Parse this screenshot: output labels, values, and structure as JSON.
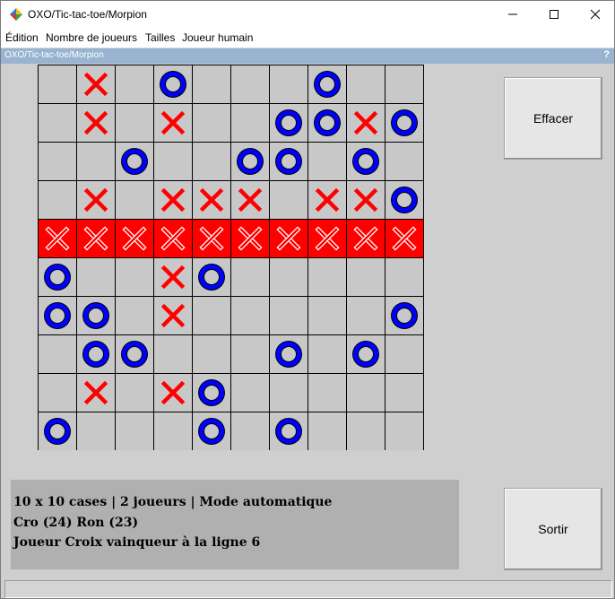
{
  "window": {
    "title": "OXO/Tic-tac-toe/Morpion",
    "controls": [
      "minimize-icon",
      "maximize-icon",
      "close-icon"
    ]
  },
  "menu": [
    {
      "label": "Édition"
    },
    {
      "label": "Nombre de joueurs"
    },
    {
      "label": "Tailles"
    },
    {
      "label": "Joueur humain"
    }
  ],
  "panel": {
    "title": "OXO/Tic-tac-toe/Morpion",
    "help": "?"
  },
  "board": {
    "rows": 10,
    "cols": 10,
    "winning_row_index": 4,
    "cells": [
      "_X_O___O__",
      "_X_X__OOXO",
      "__O__OO_O_",
      "_X_XXX_XXO",
      "XXXXXXXXXX",
      "O__XO_____",
      "OO_X_____O",
      "_OO___O_O_",
      "_X_XO_____",
      "O___O_O___"
    ],
    "colors": {
      "cross": "#ff0000",
      "circle": "#0000ff",
      "empty": "#c8c8c8",
      "win_bg": "#ff0000",
      "win_cross": "#ffffff"
    }
  },
  "buttons": {
    "clear": "Effacer",
    "exit": "Sortir"
  },
  "info": {
    "line1": "10 x 10 cases | 2 joueurs | Mode automatique",
    "line2": "Cro (24) Ron (23)",
    "line3": "Joueur Croix vainqueur à la ligne 6"
  }
}
